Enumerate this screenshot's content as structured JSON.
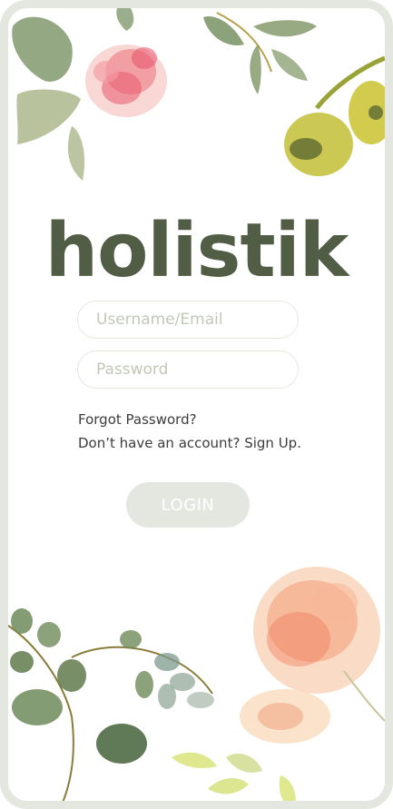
{
  "app": {
    "name": "holistik"
  },
  "login_form": {
    "username_placeholder": "Username/Email",
    "password_placeholder": "Password",
    "forgot_password_label": "Forgot Password?",
    "signup_prompt": "Don’t have an account?",
    "signup_label": "Sign Up.",
    "login_button_label": "LOGIN"
  },
  "colors": {
    "brand": "#525d46",
    "frame": "#e4e7df",
    "button_bg": "#e4e7df",
    "placeholder": "#c2c8b8"
  },
  "icons": [
    "watercolor-flower-illustration",
    "watercolor-leaves-illustration",
    "watercolor-eucalyptus-illustration"
  ]
}
